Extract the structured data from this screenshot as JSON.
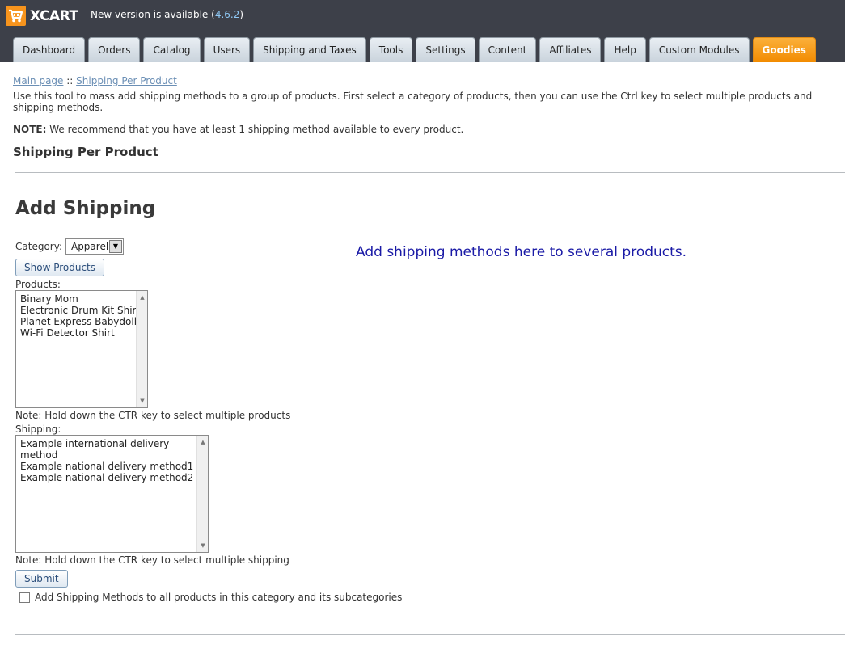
{
  "header": {
    "logo_text": "XCART",
    "new_version_prefix": "New version is available (",
    "new_version_link": "4.6.2",
    "new_version_suffix": ")"
  },
  "tabs": [
    {
      "label": "Dashboard"
    },
    {
      "label": "Orders"
    },
    {
      "label": "Catalog"
    },
    {
      "label": "Users"
    },
    {
      "label": "Shipping and Taxes"
    },
    {
      "label": "Tools"
    },
    {
      "label": "Settings"
    },
    {
      "label": "Content"
    },
    {
      "label": "Affiliates"
    },
    {
      "label": "Help"
    },
    {
      "label": "Custom Modules"
    },
    {
      "label": "Goodies"
    }
  ],
  "breadcrumb": {
    "home": "Main page",
    "separator": " :: ",
    "current": "Shipping Per Product"
  },
  "page": {
    "description": "Use this tool to mass add shipping methods to a group of products. First select a category of products, then you can use the Ctrl key to select multiple products and shipping methods.",
    "note_label": "NOTE:",
    "note_text": " We recommend that you have at least 1 shipping method available to every product.",
    "section_title": "Shipping Per Product",
    "add_title": "Add Shipping",
    "promo": "Add shipping methods here to several products."
  },
  "form": {
    "category_label": "Category:",
    "category_value": "Apparel",
    "show_products_label": "Show Products",
    "products_label": "Products:",
    "products": [
      "Binary Mom",
      "Electronic Drum Kit Shirt",
      "Planet Express Babydoll",
      "Wi-Fi Detector Shirt"
    ],
    "products_hint": "Note: Hold down the CTR key to select multiple products",
    "shipping_label": "Shipping:",
    "shipping": [
      "Example international delivery method",
      "Example national delivery method1",
      "Example national delivery method2"
    ],
    "shipping_hint": "Note: Hold down the CTR key to select multiple shipping",
    "submit_label": "Submit",
    "checkbox_label": "Add Shipping Methods to all products in this category and its subcategories"
  }
}
